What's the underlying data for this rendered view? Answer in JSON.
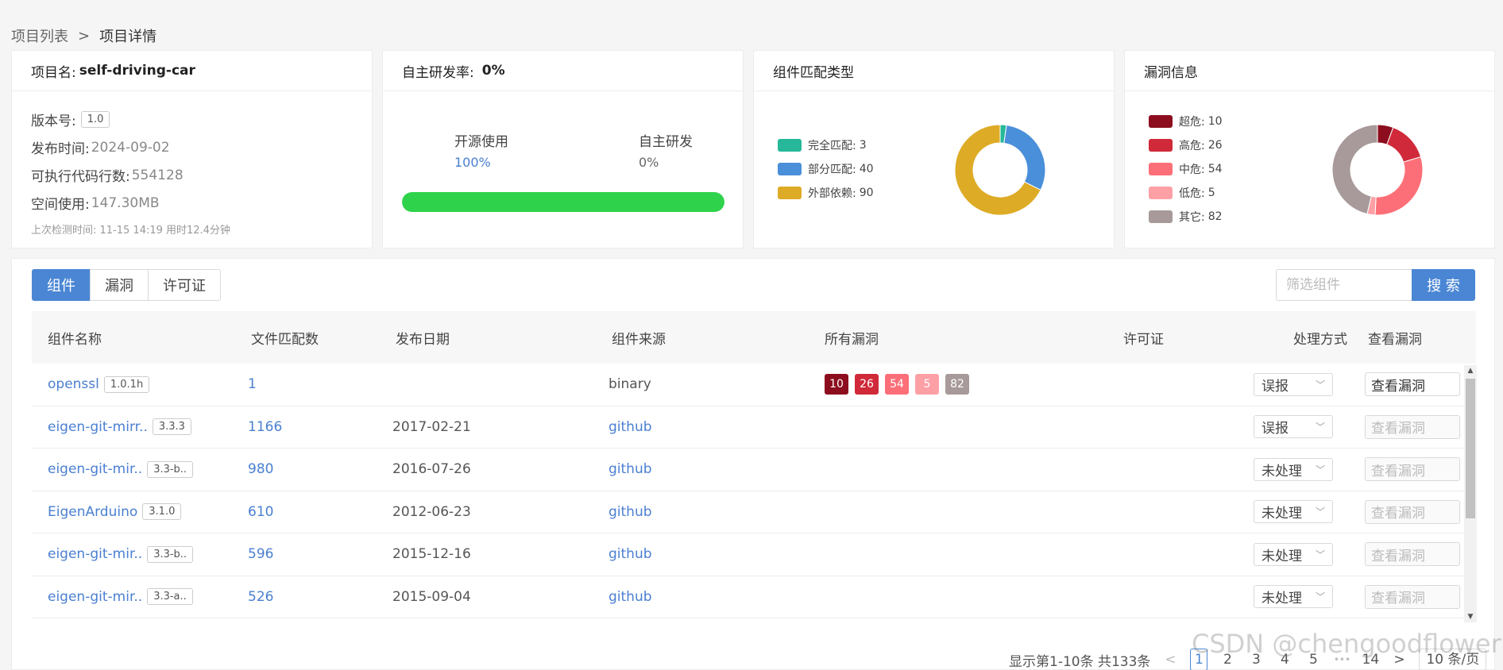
{
  "breadcrumb": {
    "root": "项目列表",
    "sep": ">",
    "current": "项目详情"
  },
  "project_card": {
    "title_label": "项目名:",
    "title_value": "self-driving-car",
    "version_label": "版本号:",
    "version_value": "1.0",
    "release_label": "发布时间:",
    "release_value": "2024-09-02",
    "loc_label": "可执行代码行数:",
    "loc_value": "554128",
    "space_label": "空间使用:",
    "space_value": "147.30MB",
    "note": "上次检测时间: 11-15 14:19  用时12.4分钟"
  },
  "rate_card": {
    "title_label": "自主研发率:",
    "title_value": "0%",
    "open_label": "开源使用",
    "open_value": "100%",
    "self_label": "自主研发",
    "self_value": "0%",
    "progress_fraction": 1.0,
    "progress_color": "#2ed34b"
  },
  "match_card": {
    "title": "组件匹配类型",
    "legend": [
      {
        "label": "完全匹配:",
        "value": "3",
        "color": "#26b899"
      },
      {
        "label": "部分匹配:",
        "value": "40",
        "color": "#4a8fd9"
      },
      {
        "label": "外部依赖:",
        "value": "90",
        "color": "#ddab26"
      }
    ]
  },
  "vuln_card": {
    "title": "漏洞信息",
    "legend": [
      {
        "label": "超危:",
        "value": "10",
        "color": "#8c0e1e"
      },
      {
        "label": "高危:",
        "value": "26",
        "color": "#d02a3a"
      },
      {
        "label": "中危:",
        "value": "54",
        "color": "#fd6f78"
      },
      {
        "label": "低危:",
        "value": "5",
        "color": "#fda0a6"
      },
      {
        "label": "其它:",
        "value": "82",
        "color": "#a89a9a"
      }
    ]
  },
  "tabs": [
    "组件",
    "漏洞",
    "许可证"
  ],
  "search": {
    "placeholder": "筛选组件",
    "button": "搜 索"
  },
  "table": {
    "headers": [
      "组件名称",
      "文件匹配数",
      "发布日期",
      "组件来源",
      "所有漏洞",
      "许可证",
      "处理方式",
      "查看漏洞"
    ],
    "rows": [
      {
        "name": "openssl",
        "version": "1.0.1h",
        "matches": "1",
        "date": "",
        "source": "binary",
        "vulns": [
          "10",
          "26",
          "54",
          "5",
          "82"
        ],
        "handling": "误报",
        "view": "查看漏洞",
        "view_enabled": true
      },
      {
        "name": "eigen-git-mirr..",
        "version": "3.3.3",
        "matches": "1166",
        "date": "2017-02-21",
        "source": "github",
        "vulns": [],
        "handling": "误报",
        "view": "查看漏洞",
        "view_enabled": false
      },
      {
        "name": "eigen-git-mir..",
        "version": "3.3-b..",
        "matches": "980",
        "date": "2016-07-26",
        "source": "github",
        "vulns": [],
        "handling": "未处理",
        "view": "查看漏洞",
        "view_enabled": false
      },
      {
        "name": "EigenArduino",
        "version": "3.1.0",
        "matches": "610",
        "date": "2012-06-23",
        "source": "github",
        "vulns": [],
        "handling": "未处理",
        "view": "查看漏洞",
        "view_enabled": false
      },
      {
        "name": "eigen-git-mir..",
        "version": "3.3-b..",
        "matches": "596",
        "date": "2015-12-16",
        "source": "github",
        "vulns": [],
        "handling": "未处理",
        "view": "查看漏洞",
        "view_enabled": false
      },
      {
        "name": "eigen-git-mir..",
        "version": "3.3-a..",
        "matches": "526",
        "date": "2015-09-04",
        "source": "github",
        "vulns": [],
        "handling": "未处理",
        "view": "查看漏洞",
        "view_enabled": false
      }
    ]
  },
  "pagination": {
    "summary": "显示第1-10条 共133条",
    "prev": "<",
    "pages": [
      "1",
      "2",
      "3",
      "4",
      "5"
    ],
    "ellipsis": "•••",
    "last": "14",
    "next": ">",
    "page_size": "10 条/页"
  },
  "watermark": "CSDN @chengoodflower"
}
